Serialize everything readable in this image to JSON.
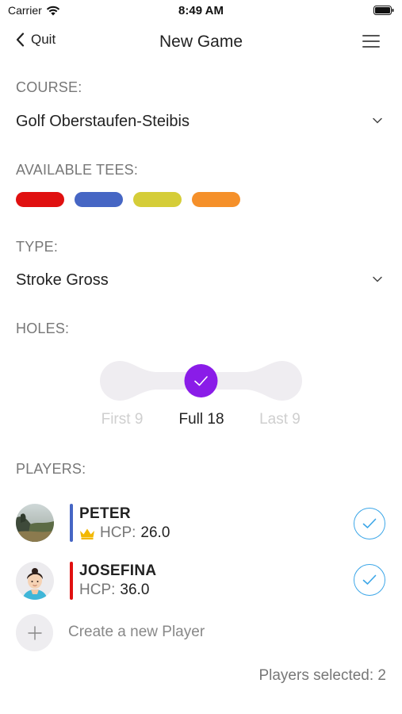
{
  "status_bar": {
    "carrier": "Carrier",
    "time": "8:49 AM"
  },
  "nav": {
    "back_label": "Quit",
    "title": "New Game"
  },
  "course": {
    "label": "COURSE:",
    "value": "Golf Oberstaufen-Steibis"
  },
  "tees": {
    "label": "AVAILABLE TEES:",
    "colors": [
      "#e01010",
      "#4666c4",
      "#d5cd38",
      "#f5902a"
    ]
  },
  "type": {
    "label": "TYPE:",
    "value": "Stroke Gross"
  },
  "holes": {
    "label": "HOLES:",
    "options": [
      "First 9",
      "Full 18",
      "Last 9"
    ],
    "selected": "Full 18",
    "accent_color": "#8a1ce8"
  },
  "players": {
    "label": "PLAYERS:",
    "hcp_prefix": "HCP:",
    "list": [
      {
        "name": "PETER",
        "hcp": "26.0",
        "bar_color": "#4666c4",
        "selected": true,
        "crown": true
      },
      {
        "name": "JOSEFINA",
        "hcp": "36.0",
        "bar_color": "#e01010",
        "selected": true,
        "crown": false
      }
    ],
    "create_label": "Create a new Player",
    "selected_count_text": "Players selected: 2",
    "check_color": "#3ba6e8"
  }
}
